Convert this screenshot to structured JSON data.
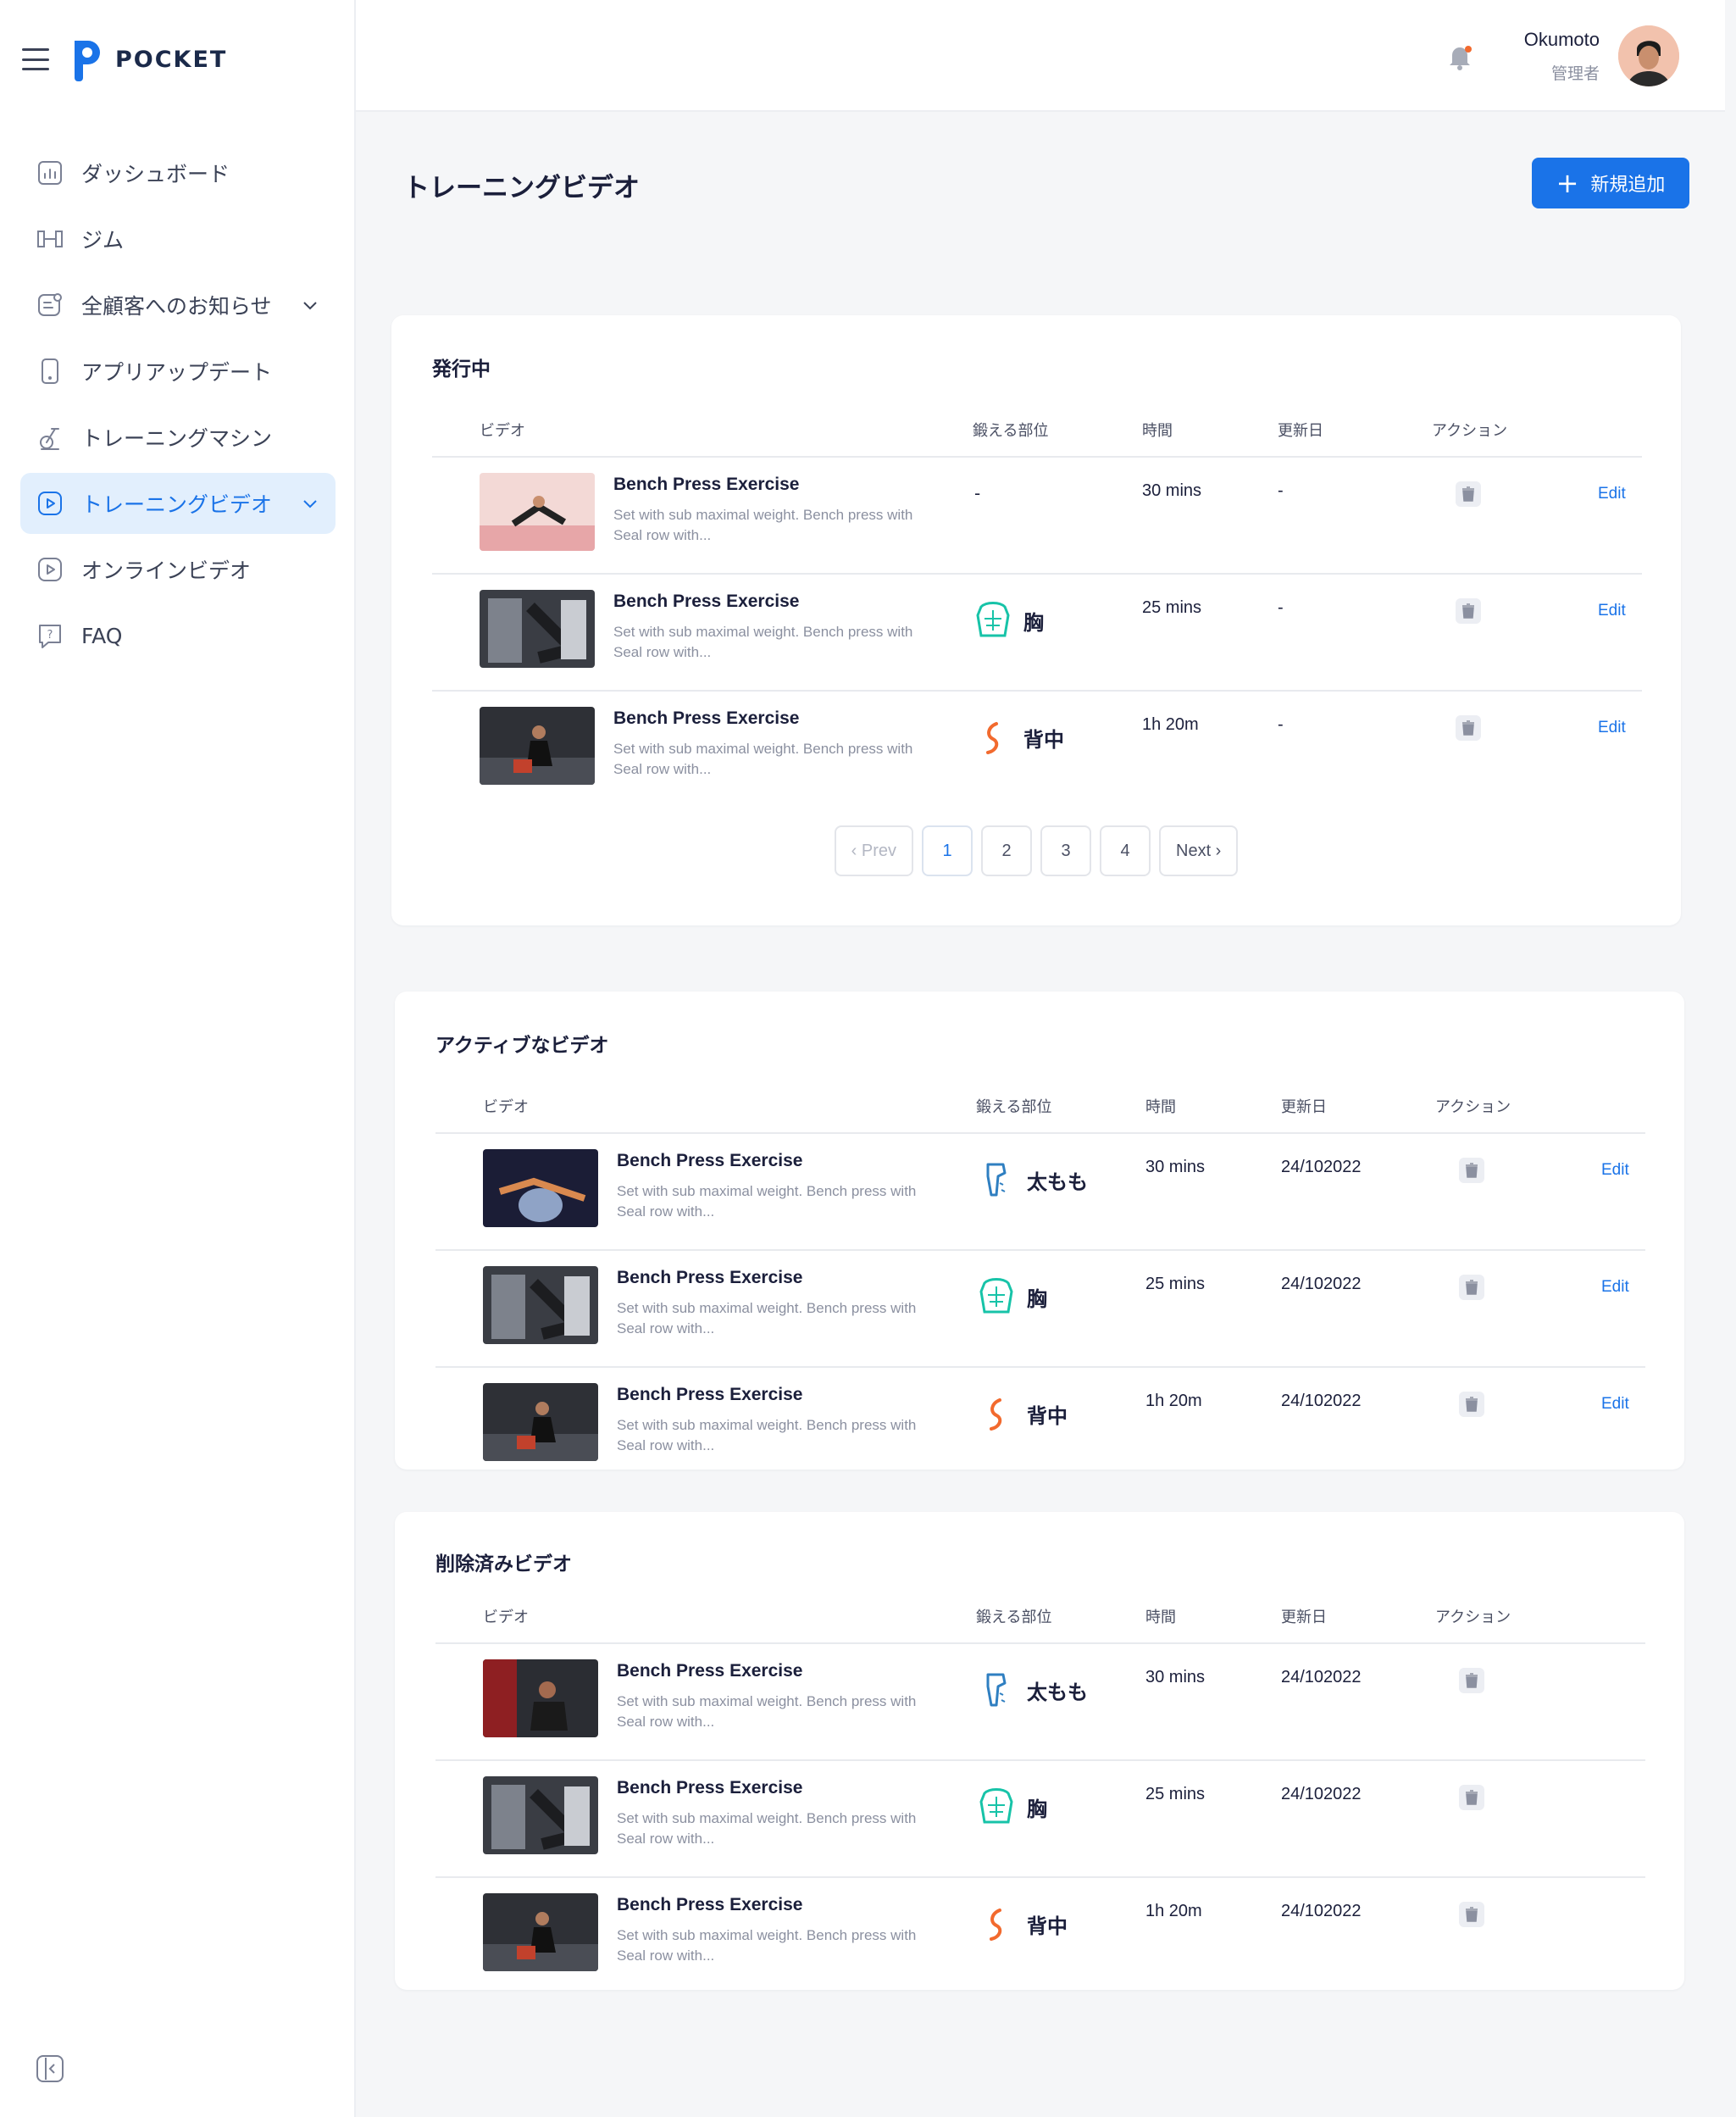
{
  "brand": {
    "name": "POCKET",
    "primary_color": "#1a73e8"
  },
  "sidebar": {
    "items": [
      {
        "label": "ダッシュボード",
        "icon": "chart-icon"
      },
      {
        "label": "ジム",
        "icon": "dumbbell-icon"
      },
      {
        "label": "全顧客へのお知らせ",
        "icon": "announcement-icon",
        "expandable": true
      },
      {
        "label": "アプリアップデート",
        "icon": "phone-icon"
      },
      {
        "label": "トレーニングマシン",
        "icon": "machine-icon"
      },
      {
        "label": "トレーニングビデオ",
        "icon": "play-icon",
        "expandable": true,
        "active": true
      },
      {
        "label": "オンラインビデオ",
        "icon": "play-icon"
      },
      {
        "label": "FAQ",
        "icon": "question-icon"
      }
    ]
  },
  "header": {
    "user_name": "Okumoto",
    "user_role": "管理者"
  },
  "page": {
    "title": "トレーニングビデオ",
    "add_button": "新規追加"
  },
  "columns": {
    "video": "ビデオ",
    "part": "鍛える部位",
    "duration": "時間",
    "updated": "更新日",
    "action": "アクション"
  },
  "sections": {
    "published": {
      "title": "発行中",
      "rows": [
        {
          "title": "Bench Press Exercise",
          "desc": "Set with sub maximal weight. Bench press with Seal row with...",
          "part": "-",
          "duration": "30 mins",
          "updated": "-",
          "edit": "Edit"
        },
        {
          "title": "Bench Press Exercise",
          "desc": "Set with sub maximal weight. Bench press with Seal row with...",
          "part": "胸",
          "duration": "25 mins",
          "updated": "-",
          "edit": "Edit"
        },
        {
          "title": "Bench Press Exercise",
          "desc": "Set with sub maximal weight. Bench press with Seal row with...",
          "part": "背中",
          "duration": "1h 20m",
          "updated": "-",
          "edit": "Edit"
        }
      ],
      "pagination": {
        "prev": "Prev",
        "pages": [
          "1",
          "2",
          "3",
          "4"
        ],
        "current": "1",
        "next": "Next"
      }
    },
    "active": {
      "title": "アクティブなビデオ",
      "rows": [
        {
          "title": "Bench Press Exercise",
          "desc": "Set with sub maximal weight. Bench press with Seal row with...",
          "part": "太もも",
          "duration": "30 mins",
          "updated": "24/102022",
          "edit": "Edit"
        },
        {
          "title": "Bench Press Exercise",
          "desc": "Set with sub maximal weight. Bench press with Seal row with...",
          "part": "胸",
          "duration": "25 mins",
          "updated": "24/102022",
          "edit": "Edit"
        },
        {
          "title": "Bench Press Exercise",
          "desc": "Set with sub maximal weight. Bench press with Seal row with...",
          "part": "背中",
          "duration": "1h 20m",
          "updated": "24/102022",
          "edit": "Edit"
        }
      ]
    },
    "deleted": {
      "title": "削除済みビデオ",
      "rows": [
        {
          "title": "Bench Press Exercise",
          "desc": "Set with sub maximal weight. Bench press with Seal row with...",
          "part": "太もも",
          "duration": "30 mins",
          "updated": "24/102022"
        },
        {
          "title": "Bench Press Exercise",
          "desc": "Set with sub maximal weight. Bench press with Seal row with...",
          "part": "胸",
          "duration": "25 mins",
          "updated": "24/102022"
        },
        {
          "title": "Bench Press Exercise",
          "desc": "Set with sub maximal weight. Bench press with Seal row with...",
          "part": "背中",
          "duration": "1h 20m",
          "updated": "24/102022"
        }
      ]
    }
  },
  "body_part_colors": {
    "胸": "#17c3a8",
    "背中": "#f26a2e",
    "太もも": "#2f7fc1"
  }
}
